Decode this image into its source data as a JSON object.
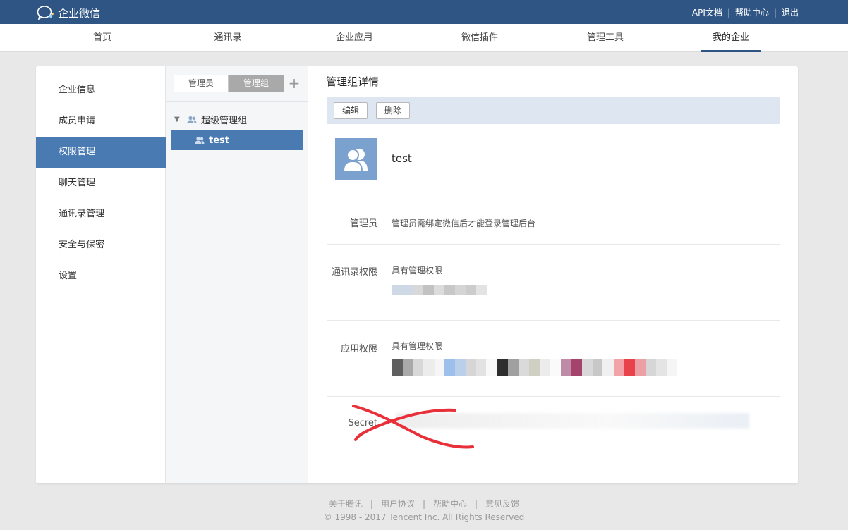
{
  "app": {
    "logo_text": "企业微信"
  },
  "toplinks": {
    "api_docs": "API文档",
    "help": "帮助中心",
    "logout": "退出",
    "separator": "|"
  },
  "nav": {
    "items": [
      {
        "label": "首页"
      },
      {
        "label": "通讯录"
      },
      {
        "label": "企业应用"
      },
      {
        "label": "微信插件"
      },
      {
        "label": "管理工具"
      },
      {
        "label": "我的企业",
        "active": true
      }
    ]
  },
  "sidebar": {
    "items": [
      {
        "label": "企业信息"
      },
      {
        "label": "成员申请"
      },
      {
        "label": "权限管理",
        "active": true
      },
      {
        "label": "聊天管理"
      },
      {
        "label": "通讯录管理"
      },
      {
        "label": "安全与保密"
      },
      {
        "label": "设置"
      }
    ]
  },
  "tabs": {
    "admins": "管理员",
    "groups": "管理组",
    "add": "+"
  },
  "tree": {
    "arrow": "▼",
    "root": "超级管理组",
    "child": "test"
  },
  "detail": {
    "title": "管理组详情",
    "edit_button": "编辑",
    "delete_button": "删除",
    "group_name": "test",
    "admin_label": "管理员",
    "admin_value": "管理员需绑定微信后才能登录管理后台",
    "contacts_label": "通讯录权限",
    "contacts_value": "具有管理权限",
    "apps_label": "应用权限",
    "apps_value": "具有管理权限",
    "secret_label": "Secret"
  },
  "footer": {
    "links": [
      "关于腾讯",
      "用户协议",
      "帮助中心",
      "意见反馈"
    ],
    "separator": "|",
    "copyright": "© 1998 - 2017 Tencent Inc. All Rights Reserved"
  },
  "colors": {
    "topbar": "#2f5584",
    "accent": "#4a7ab2",
    "toolbar": "#dde6f1",
    "avatar": "#7ba1cf",
    "annotation": "#e8303a"
  }
}
